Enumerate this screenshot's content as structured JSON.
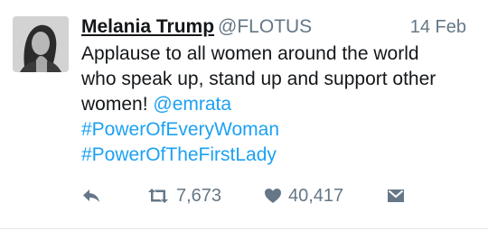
{
  "tweet": {
    "author": {
      "display_name": "Melania Trump",
      "handle": "@FLOTUS",
      "avatar_icon": "profile-photo"
    },
    "date": "14 Feb",
    "text": {
      "line1": "Applause to all women around the world",
      "line2": "who speak up, stand up and support other",
      "line3_prefix": "women! ",
      "mention": "@emrata",
      "hashtag1": "#PowerOfEveryWoman",
      "hashtag2": "#PowerOfTheFirstLady"
    },
    "actions": {
      "reply_icon": "reply-icon",
      "retweet_icon": "retweet-icon",
      "retweet_count": "7,673",
      "like_icon": "heart-icon",
      "like_count": "40,417",
      "dm_icon": "direct-message-icon"
    }
  },
  "colors": {
    "link": "#1da1f2",
    "muted": "#657786",
    "text": "#14171a",
    "divider": "#e1e8ed"
  }
}
